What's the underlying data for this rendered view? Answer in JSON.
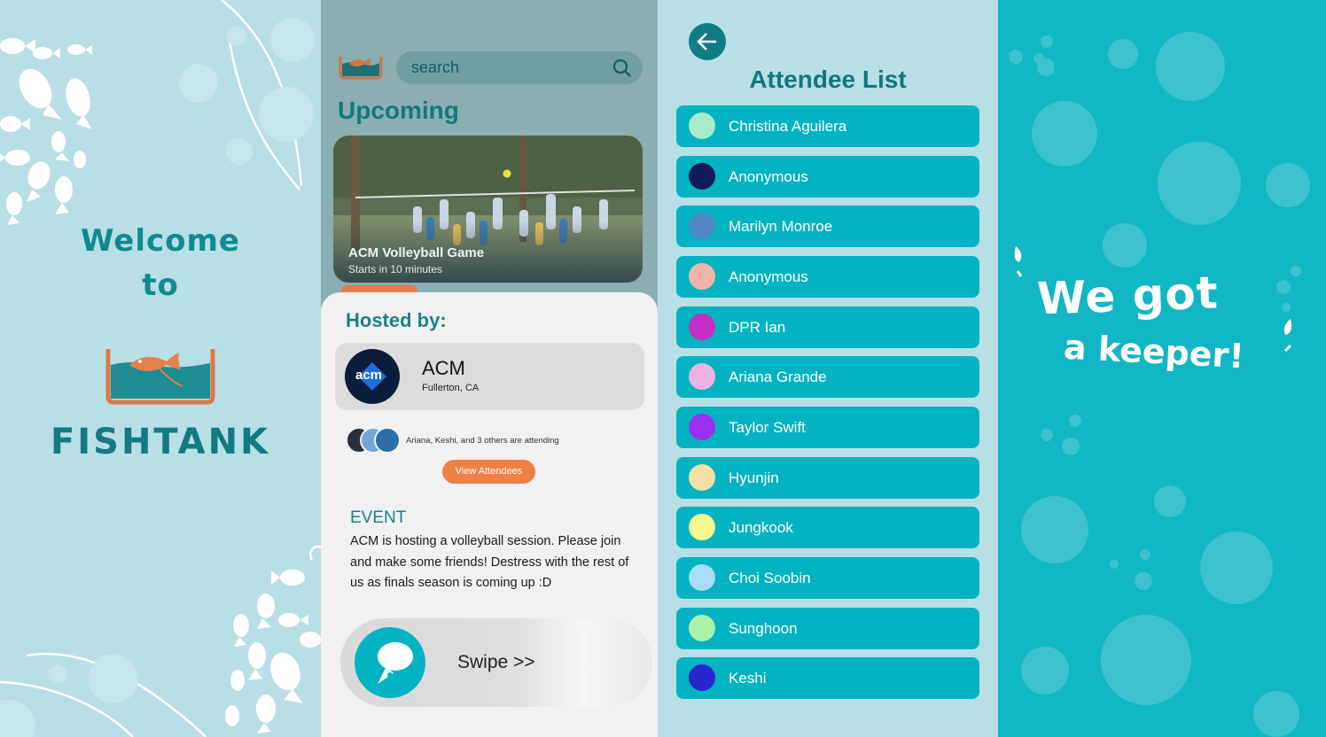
{
  "welcome_panel": {
    "line1": "Welcome",
    "line2": "to",
    "brand": "FISHTANK"
  },
  "event_panel": {
    "search_placeholder": "search",
    "section_title": "Upcoming",
    "event_card": {
      "title": "ACM Volleyball Game",
      "subtitle": "Starts in 10 minutes"
    },
    "hosted_by_label": "Hosted by:",
    "host": {
      "logo_text": "acm",
      "name": "ACM",
      "location": "Fullerton, CA"
    },
    "attending_text": "Ariana, Keshi, and 3 others are attending",
    "view_attendees_label": "View Attendees",
    "event_heading": "EVENT",
    "event_description": "ACM is hosting a volleyball session. Please join and make some friends! Destress with the rest of us as finals season is coming up :D",
    "swipe_label": "Swipe >>"
  },
  "attendee_panel": {
    "title": "Attendee List",
    "attendees": [
      {
        "name": "Christina Aguilera",
        "color": "#a6ecc8"
      },
      {
        "name": "Anonymous",
        "color": "#121a5a"
      },
      {
        "name": "Marilyn Monroe",
        "color": "#4f86c6"
      },
      {
        "name": "Anonymous",
        "color": "#f2b4a8"
      },
      {
        "name": "DPR Ian",
        "color": "#c42fc6"
      },
      {
        "name": "Ariana Grande",
        "color": "#eeb3e6"
      },
      {
        "name": "Taylor Swift",
        "color": "#9a2ff2"
      },
      {
        "name": "Hyunjin",
        "color": "#f2e0a8"
      },
      {
        "name": "Jungkook",
        "color": "#f6f892"
      },
      {
        "name": "Choi Soobin",
        "color": "#a9dcf6"
      },
      {
        "name": "Sunghoon",
        "color": "#a6f2a8"
      },
      {
        "name": "Keshi",
        "color": "#2a26cf"
      }
    ]
  },
  "keeper_panel": {
    "line1": "We got",
    "line2": "a keeper!"
  },
  "colors": {
    "teal_dark": "#127a80",
    "teal_bright": "#04b3c2",
    "panel_light": "#b8dfe5",
    "orange": "#ee8148"
  }
}
